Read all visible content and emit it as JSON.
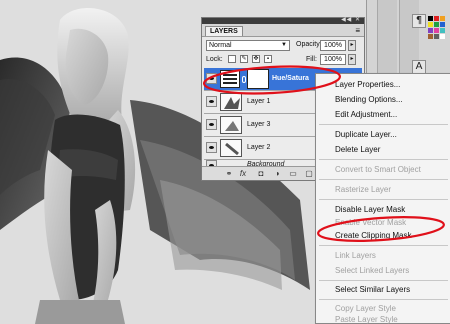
{
  "panel": {
    "title": "LAYERS",
    "controls": "◀◀ ✕",
    "menu_icon": "≡",
    "blend_mode": "Normal",
    "opacity_label": "Opacity:",
    "opacity_value": "100%",
    "lock_label": "Lock:",
    "fill_label": "Fill:",
    "fill_value": "100%",
    "layers": [
      {
        "name": "Hue/Satura",
        "type": "adjustment",
        "selected": true
      },
      {
        "name": "Layer 1",
        "type": "pixel"
      },
      {
        "name": "Layer 3",
        "type": "pixel"
      },
      {
        "name": "Layer 2",
        "type": "pixel"
      },
      {
        "name": "Background",
        "type": "pixel",
        "italic": true
      }
    ],
    "footer_icons": [
      "link-icon",
      "fx-icon",
      "mask-icon",
      "adjustment-icon",
      "group-icon",
      "new-layer-icon",
      "trash-icon"
    ],
    "footer_glyphs": [
      "⚭",
      "fx",
      "◘",
      "◑",
      "▭",
      "▢",
      "🗑"
    ]
  },
  "context_menu": {
    "items": [
      {
        "label": "Layer Properties...",
        "enabled": true
      },
      {
        "label": "Blending Options...",
        "enabled": true
      },
      {
        "label": "Edit Adjustment...",
        "enabled": true
      },
      {
        "label": "Duplicate Layer...",
        "enabled": true
      },
      {
        "label": "Delete Layer",
        "enabled": true
      },
      {
        "label": "Convert to Smart Object",
        "enabled": false
      },
      {
        "label": "Rasterize Layer",
        "enabled": false
      },
      {
        "label": "Disable Layer Mask",
        "enabled": true
      },
      {
        "label": "Enable Vector Mask",
        "enabled": false
      },
      {
        "label": "Create Clipping Mask",
        "enabled": true,
        "highlighted": true
      },
      {
        "label": "Link Layers",
        "enabled": false
      },
      {
        "label": "Select Linked Layers",
        "enabled": false
      },
      {
        "label": "Select Similar Layers",
        "enabled": true
      },
      {
        "label": "Copy Layer Style",
        "enabled": false
      },
      {
        "label": "Paste Layer Style",
        "enabled": false
      }
    ]
  },
  "toolstrip": {
    "glyphs": [
      "¶",
      "A"
    ]
  },
  "colors": {
    "selection_blue": "#3874d8",
    "annotation_red": "#e0101a",
    "panel_gray": "#d6d6d6"
  }
}
